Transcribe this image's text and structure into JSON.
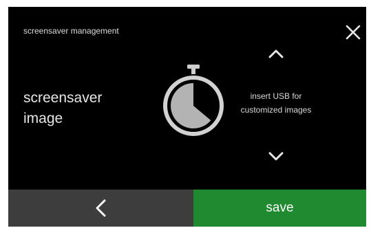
{
  "header": {
    "title": "screensaver management",
    "close_icon": "close-icon"
  },
  "setting": {
    "label_line1": "screensaver",
    "label_line2": "image",
    "preview_icon": "stopwatch-icon"
  },
  "selector": {
    "up_icon": "chevron-up-icon",
    "down_icon": "chevron-down-icon",
    "message_line1": "insert USB for",
    "message_line2": "customized images"
  },
  "footer": {
    "back_icon": "chevron-left-icon",
    "save_label": "save"
  },
  "colors": {
    "background": "#000000",
    "back_button": "#3d3d3d",
    "save_button": "#1f8a2f",
    "icon": "#d9d9d9",
    "timer_fill": "#b3b3b3"
  }
}
